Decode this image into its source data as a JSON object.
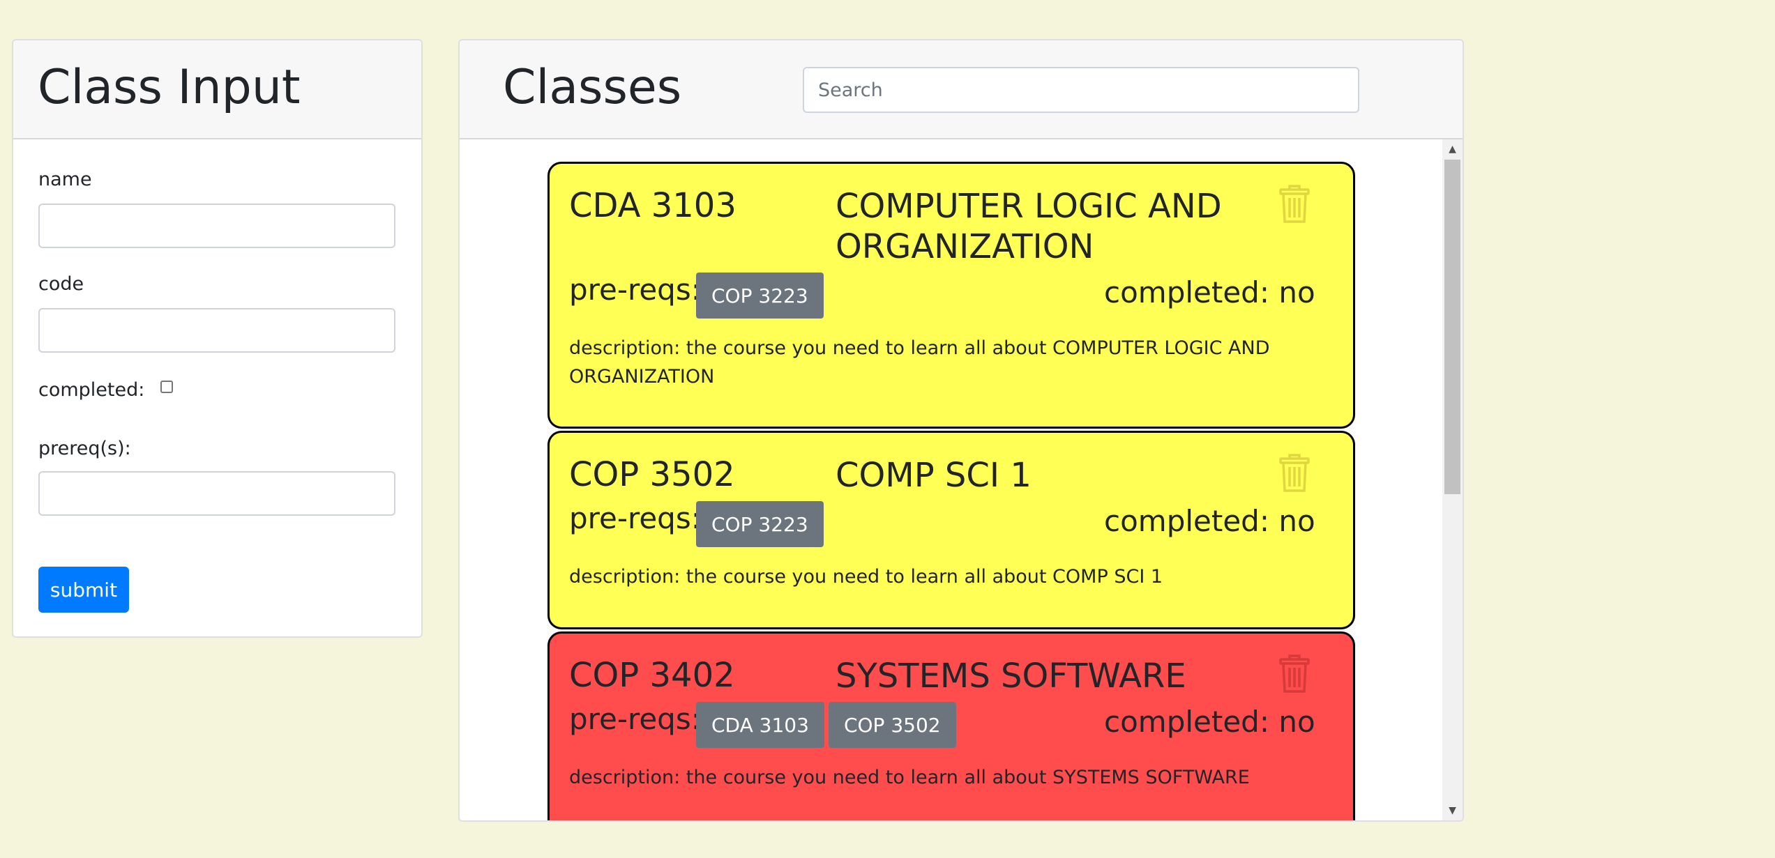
{
  "input_panel": {
    "title": "Class Input",
    "name_label": "name",
    "code_label": "code",
    "completed_label": "completed:",
    "prereq_label": "prereq(s):",
    "name_value": "",
    "code_value": "",
    "prereq_value": "",
    "submit_label": "submit"
  },
  "classes_panel": {
    "title": "Classes",
    "search_placeholder": "Search",
    "classes": [
      {
        "code": "CDA 3103",
        "name": "COMPUTER LOGIC AND ORGANIZATION",
        "prereq_label": "pre-reqs:",
        "prereqs": [
          "COP 3223"
        ],
        "completed": "completed: no",
        "description": "description: the course you need to learn all about COMPUTER LOGIC AND ORGANIZATION",
        "color": "#ffff55"
      },
      {
        "code": "COP 3502",
        "name": "COMP SCI 1",
        "prereq_label": "pre-reqs:",
        "prereqs": [
          "COP 3223"
        ],
        "completed": "completed: no",
        "description": "description: the course you need to learn all about COMP SCI 1",
        "color": "#ffff55"
      },
      {
        "code": "COP 3402",
        "name": "SYSTEMS SOFTWARE",
        "prereq_label": "pre-reqs:",
        "prereqs": [
          "CDA 3103",
          "COP 3502"
        ],
        "completed": "completed: no",
        "description": "description: the course you need to learn all about SYSTEMS SOFTWARE",
        "color": "#ff4d4d"
      }
    ]
  },
  "colors": {
    "page_background": "#f5f5dc",
    "primary": "#007bff",
    "badge": "#6c757d"
  }
}
